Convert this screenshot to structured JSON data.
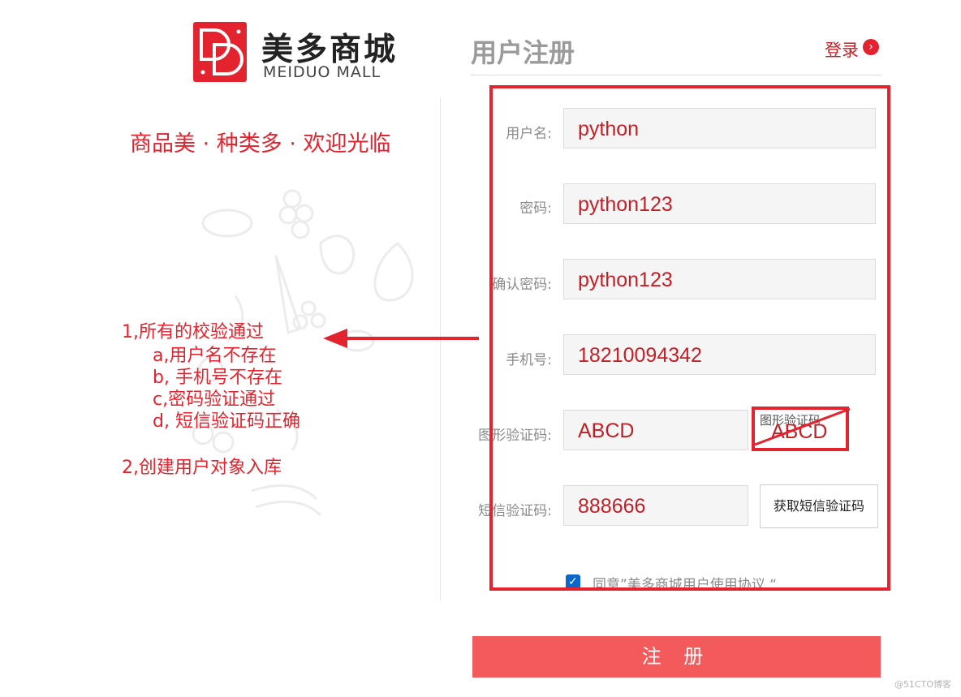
{
  "brand": {
    "logo_letters": "DD",
    "name_cn": "美多商城",
    "name_en": "MEIDUO MALL",
    "slogan": "商品美 · 种类多 · 欢迎光临"
  },
  "annotation": {
    "line1": "1,所有的校验通过",
    "items": [
      "a,用户名不存在",
      "b, 手机号不存在",
      "c,密码验证通过",
      "d, 短信验证码正确"
    ],
    "line2": "2,创建用户对象入库"
  },
  "form": {
    "title": "用户注册",
    "login_link": "登录",
    "login_arrow": "›",
    "fields": {
      "username": {
        "label": "用户名:",
        "value": "python"
      },
      "password": {
        "label": "密码:",
        "value": "python123"
      },
      "password2": {
        "label": "确认密码:",
        "value": "python123"
      },
      "mobile": {
        "label": "手机号:",
        "value": "18210094342"
      },
      "image_code": {
        "label": "图形验证码:",
        "value": "ABCD"
      },
      "sms_code": {
        "label": "短信验证码:",
        "value": "888666"
      }
    },
    "captcha_alt": "图形验证码",
    "captcha_text": "ABCD",
    "sms_button": "获取短信验证码",
    "agree_check": "✓",
    "agree_text": "同意”美多商城用户使用协议 “",
    "submit": "注 册"
  },
  "watermark": "@51CTO博客",
  "colors": {
    "brand_red": "#e3232d",
    "submit_bg": "#f25a5c",
    "checkbox_blue": "#0b67c9"
  }
}
